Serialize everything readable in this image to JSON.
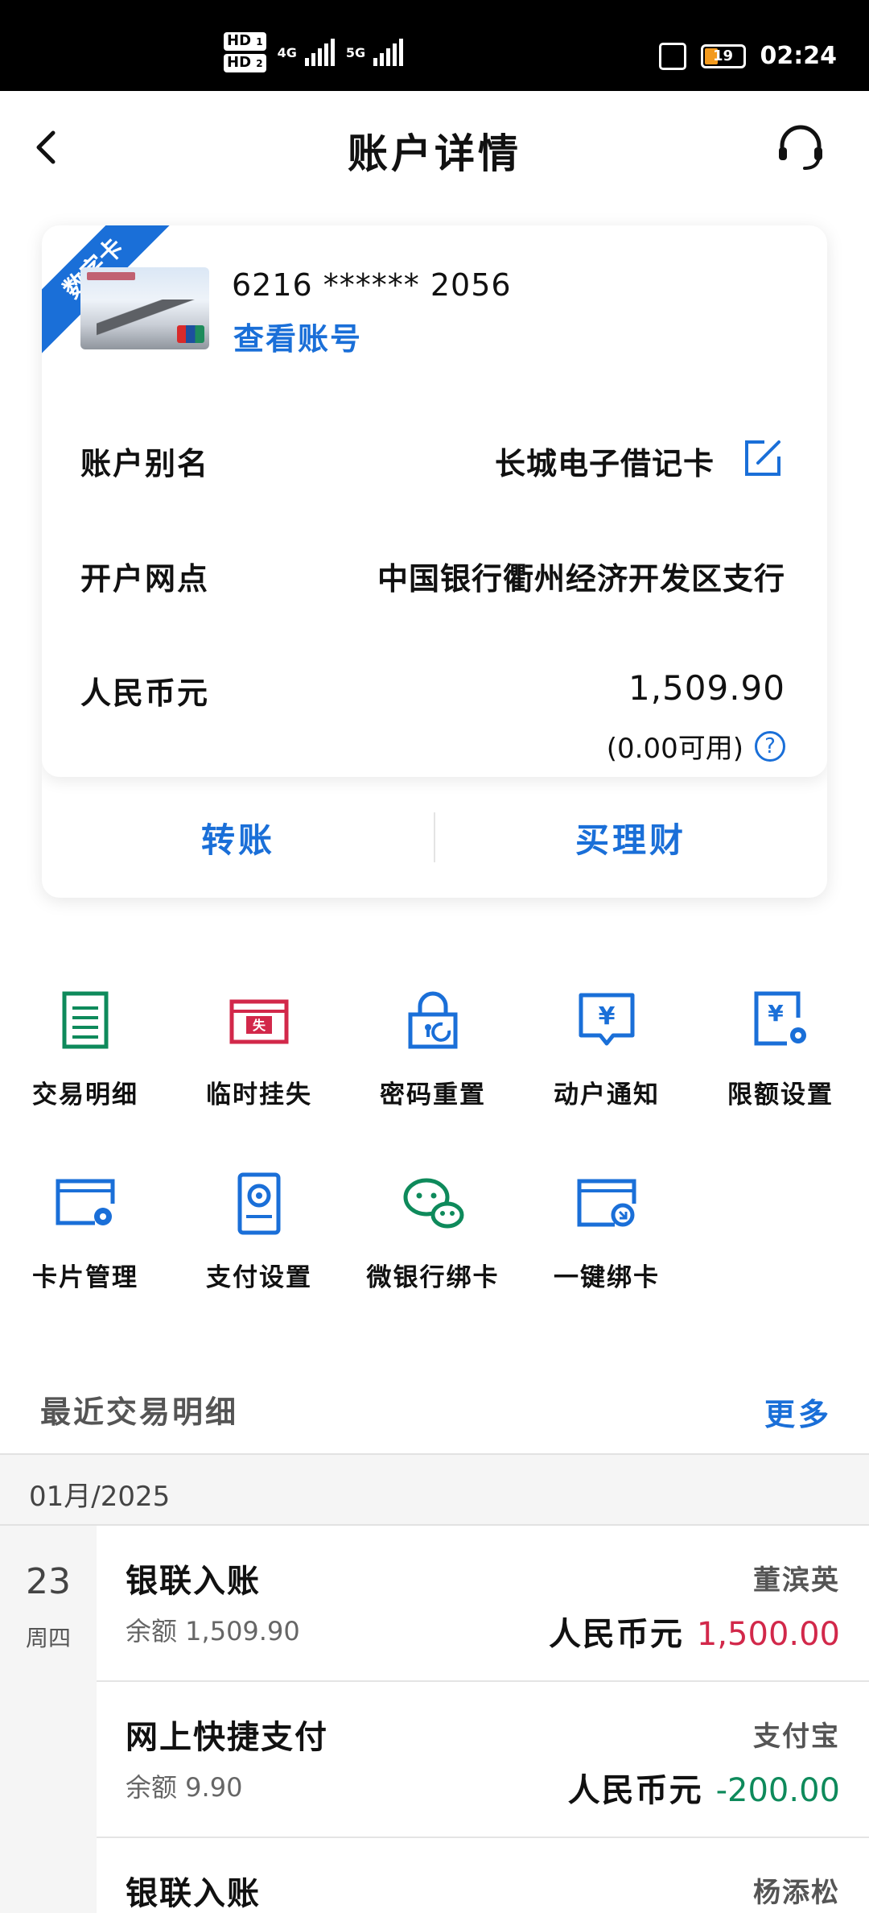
{
  "status_bar": {
    "hd1": "HD",
    "hd1_sub": "1",
    "hd2": "HD",
    "hd2_sub": "2",
    "net1": "4G",
    "net2": "5G",
    "battery": "19",
    "time": "02:24"
  },
  "header": {
    "title": "账户详情"
  },
  "card": {
    "ribbon": "数字卡",
    "number": "6216 ****** 2056",
    "view_account": "查看账号",
    "alias_label": "账户别名",
    "alias_value": "长城电子借记卡",
    "branch_label": "开户网点",
    "branch_value": "中国银行衢州经济开发区支行",
    "currency_label": "人民币元",
    "balance": "1,509.90",
    "available": "(0.00可用)",
    "actions": {
      "transfer": "转账",
      "finance": "买理财"
    }
  },
  "functions": [
    {
      "label": "交易明细",
      "icon": "list-doc-icon"
    },
    {
      "label": "临时挂失",
      "icon": "lost-card-icon"
    },
    {
      "label": "密码重置",
      "icon": "lock-reset-icon"
    },
    {
      "label": "动户通知",
      "icon": "yuan-message-icon"
    },
    {
      "label": "限额设置",
      "icon": "yuan-gear-icon"
    },
    {
      "label": "卡片管理",
      "icon": "card-gear-icon"
    },
    {
      "label": "支付设置",
      "icon": "phone-gear-icon"
    },
    {
      "label": "微银行绑卡",
      "icon": "wechat-icon"
    },
    {
      "label": "一键绑卡",
      "icon": "card-link-icon"
    }
  ],
  "recent": {
    "title": "最近交易明细",
    "more": "更多",
    "month": "01月/2025",
    "day": "23",
    "weekday": "周四",
    "transactions": [
      {
        "name": "银联入账",
        "balance": "余额 1,509.90",
        "party": "董滨英",
        "currency": "人民币元",
        "amount": "1,500.00",
        "direction": "in"
      },
      {
        "name": "网上快捷支付",
        "balance": "余额 9.90",
        "party": "支付宝",
        "currency": "人民币元",
        "amount": "-200.00",
        "direction": "out"
      },
      {
        "name": "银联入账",
        "balance": "",
        "party": "杨添松",
        "currency": "",
        "amount": "",
        "direction": "in"
      }
    ]
  },
  "colors": {
    "accent": "#1a6fd8",
    "income": "#d2284a",
    "expense": "#0e8a5b",
    "green_icon": "#0e8a5b",
    "red_icon": "#d2284a"
  }
}
